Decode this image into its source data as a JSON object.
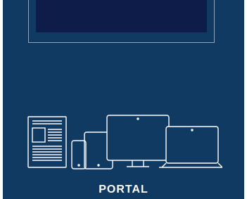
{
  "card": {
    "title": "PORTAL"
  },
  "icons": [
    "newspaper-icon",
    "smartphone-icon",
    "tablet-icon",
    "desktop-monitor-icon",
    "laptop-icon"
  ],
  "colors": {
    "background": "#103a62",
    "screen": "#0e1c4a",
    "frame": "#8fa3bb",
    "text": "#ffffff"
  }
}
